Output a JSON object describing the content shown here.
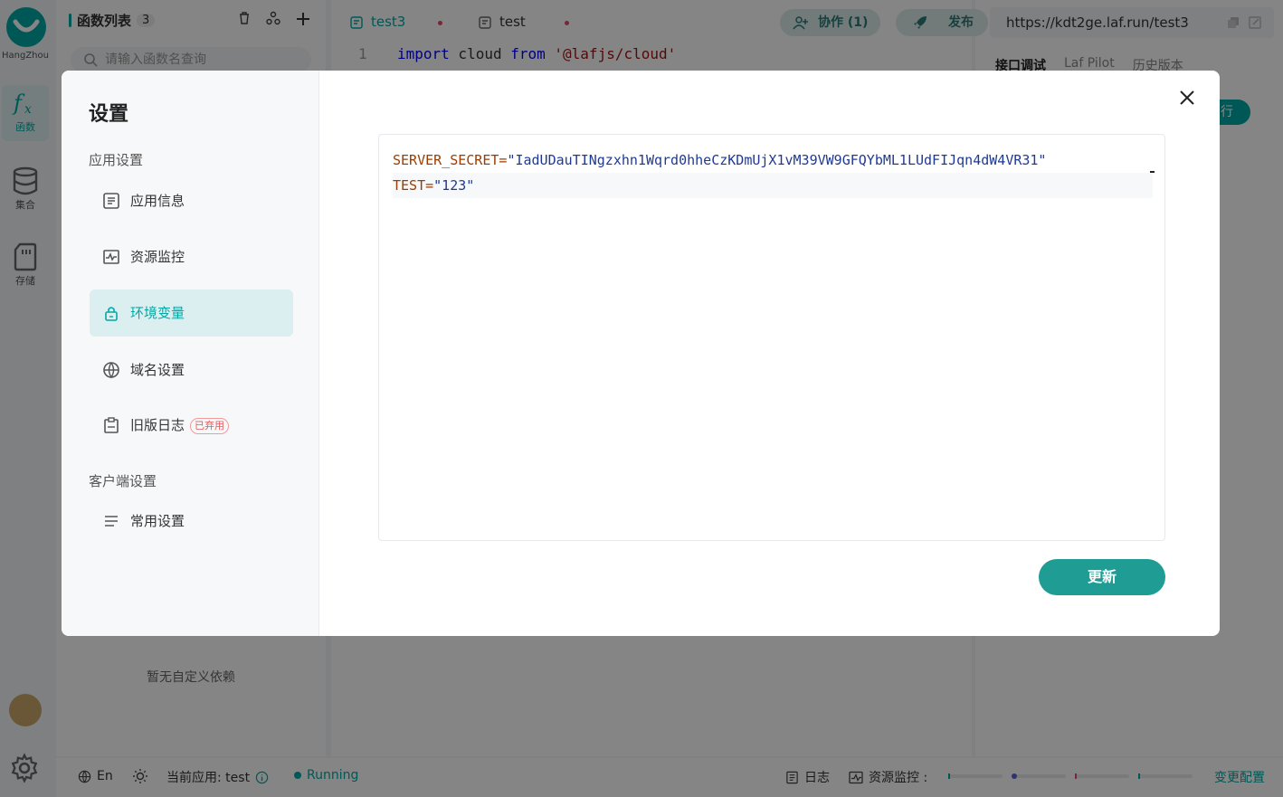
{
  "rail": {
    "region": "HangZhou",
    "functions_label": "函数",
    "collections_label": "集合",
    "storage_label": "存储"
  },
  "fn_panel": {
    "title": "函数列表",
    "count": "3",
    "search_placeholder": "请输入函数名查询",
    "empty_dependencies": "暂无自定义依赖"
  },
  "editor": {
    "tabs": [
      {
        "label": "test3"
      },
      {
        "label": "test"
      }
    ],
    "line_number": "1",
    "code": {
      "kw1": "import",
      "ident": " cloud ",
      "kw2": "from",
      "str": " '@lafjs/cloud'"
    }
  },
  "header": {
    "collab_label": "协作 (1)",
    "publish_label": "发布",
    "url": "https://kdt2ge.laf.run/test3"
  },
  "right_panel": {
    "tabs": [
      "接口调试",
      "Laf Pilot",
      "历史版本"
    ],
    "run_label": "行"
  },
  "status_bar": {
    "language": "En",
    "current_app": "当前应用: test",
    "running": "Running",
    "logs": "日志",
    "monitor": "资源监控 :",
    "change_config": "变更配置"
  },
  "modal": {
    "title": "设置",
    "app_settings_group": "应用设置",
    "client_settings_group": "客户端设置",
    "items": [
      {
        "label": "应用信息"
      },
      {
        "label": "资源监控"
      },
      {
        "label": "环境变量"
      },
      {
        "label": "域名设置"
      },
      {
        "label": "旧版日志",
        "badge": "已弃用"
      },
      {
        "label": "常用设置"
      }
    ],
    "env_lines": [
      {
        "key": "SERVER_SECRET=",
        "value": "\"IadUDauTINgzxhn1Wqrd0hheCzKDmUjX1vM39VW9GFQYbML1LUdFIJqn4dW4VR31\""
      },
      {
        "key": "TEST=",
        "value": "\"123\""
      }
    ],
    "update_label": "更新"
  },
  "colors": {
    "accent": "#00a9a6",
    "update_button": "#1f9c94",
    "deprecated": "#e35b5b"
  }
}
